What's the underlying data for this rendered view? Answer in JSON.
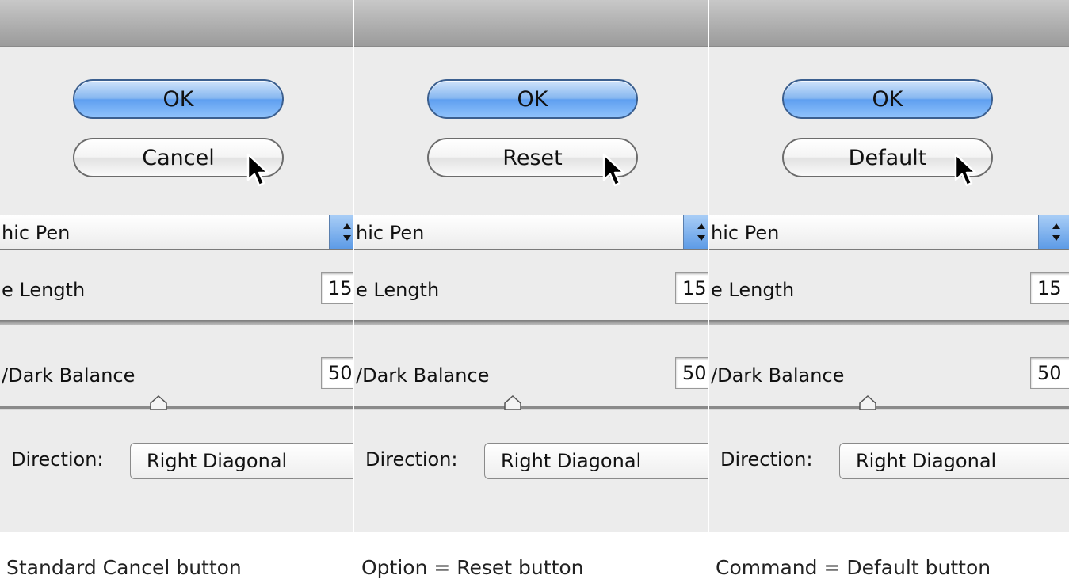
{
  "panels": [
    {
      "ok_label": "OK",
      "secondary_label": "Cancel",
      "popup_value": "hic Pen",
      "stroke_label": "e Length",
      "stroke_value": "15",
      "balance_label": "/Dark Balance",
      "balance_value": "50",
      "direction_label": "Direction:",
      "direction_value": "Right Diagonal",
      "caption": "Standard Cancel button"
    },
    {
      "ok_label": "OK",
      "secondary_label": "Reset",
      "popup_value": "hic Pen",
      "stroke_label": "e Length",
      "stroke_value": "15",
      "balance_label": "/Dark Balance",
      "balance_value": "50",
      "direction_label": "Direction:",
      "direction_value": "Right Diagonal",
      "caption": "Option = Reset button"
    },
    {
      "ok_label": "OK",
      "secondary_label": "Default",
      "popup_value": "hic Pen",
      "stroke_label": "e Length",
      "stroke_value": "15",
      "balance_label": "/Dark Balance",
      "balance_value": "50",
      "direction_label": "Direction:",
      "direction_value": "Right Diagonal",
      "caption": "Command = Default button"
    }
  ],
  "colors": {
    "ok_button": "#6aa6f0",
    "dialog_background": "#ececec",
    "titlebar": "#b0b0b0"
  },
  "icons": [
    "cursor-arrow-icon",
    "popup-arrows-icon",
    "slider-thumb-icon"
  ]
}
